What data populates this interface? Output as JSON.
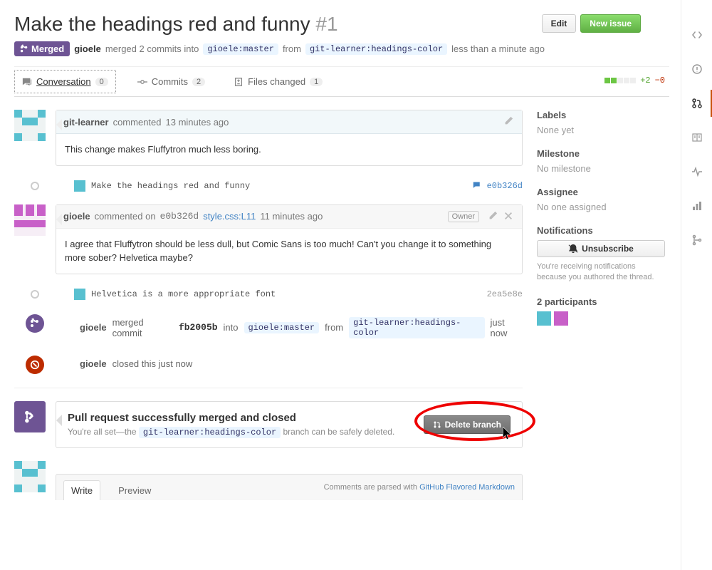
{
  "header": {
    "title": "Make the headings red and funny",
    "number": "#1",
    "edit_label": "Edit",
    "new_issue_label": "New issue"
  },
  "state": {
    "badge": "Merged",
    "user": "gioele",
    "verb": "merged 2 commits into",
    "base_branch": "gioele:master",
    "from_word": "from",
    "head_branch": "git-learner:headings-color",
    "time": "less than a minute ago"
  },
  "tabs": {
    "conversation": {
      "label": "Conversation",
      "count": "0"
    },
    "commits": {
      "label": "Commits",
      "count": "2"
    },
    "files": {
      "label": "Files changed",
      "count": "1"
    }
  },
  "diffstat": {
    "additions": "+2",
    "deletions": "−0"
  },
  "timeline": {
    "comment1": {
      "user": "git-learner",
      "verb": "commented",
      "time": "13 minutes ago",
      "body": "This change makes Fluffytron much less boring."
    },
    "commit1": {
      "msg": "Make the headings red and funny",
      "sha": "e0b326d"
    },
    "comment2": {
      "user": "gioele",
      "verb": "commented on",
      "ref": "e0b326d",
      "file": "style.css:L11",
      "time": "11 minutes ago",
      "owner_label": "Owner",
      "body": "I agree that Fluffytron should be less dull, but Comic Sans is too much! Can't you change it to something more sober? Helvetica maybe?"
    },
    "commit2": {
      "msg": "Helvetica is a more appropriate font",
      "sha": "2ea5e8e"
    },
    "merge_event": {
      "user": "gioele",
      "verb": "merged commit",
      "sha": "fb2005b",
      "into_word": "into",
      "base": "gioele:master",
      "from_word": "from",
      "head": "git-learner:headings-color",
      "time": "just now"
    },
    "close_event": {
      "user": "gioele",
      "text": "closed this just now"
    }
  },
  "merged_box": {
    "headline": "Pull request successfully merged and closed",
    "desc_prefix": "You're all set—the",
    "branch": "git-learner:headings-color",
    "desc_suffix": "branch can be safely deleted.",
    "delete_label": "Delete branch"
  },
  "compose": {
    "write_label": "Write",
    "preview_label": "Preview",
    "help_prefix": "Comments are parsed with ",
    "help_link": "GitHub Flavored Markdown"
  },
  "sidebar": {
    "labels": {
      "title": "Labels",
      "value": "None yet"
    },
    "milestone": {
      "title": "Milestone",
      "value": "No milestone"
    },
    "assignee": {
      "title": "Assignee",
      "value": "No one assigned"
    },
    "notifications": {
      "title": "Notifications",
      "button": "Unsubscribe",
      "help": "You're receiving notifications because you authored the thread."
    },
    "participants": {
      "title": "2 participants"
    }
  }
}
